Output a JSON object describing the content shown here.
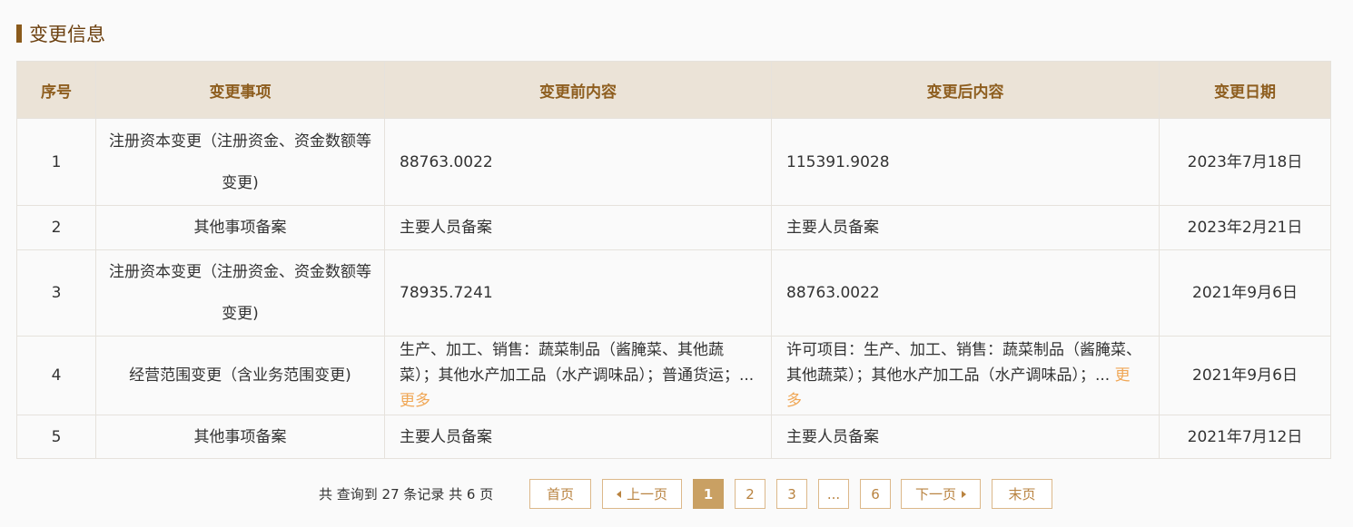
{
  "section": {
    "title": "变更信息"
  },
  "table": {
    "headers": [
      "序号",
      "变更事项",
      "变更前内容",
      "变更后内容",
      "变更日期"
    ],
    "rows": [
      {
        "index": "1",
        "item": "注册资本变更（注册资金、资金数额等变更)",
        "before": "88763.0022",
        "before_more": "",
        "after": "115391.9028",
        "after_more": "",
        "date": "2023年7月18日"
      },
      {
        "index": "2",
        "item": "其他事项备案",
        "before": "主要人员备案",
        "before_more": "",
        "after": "主要人员备案",
        "after_more": "",
        "date": "2023年2月21日"
      },
      {
        "index": "3",
        "item": "注册资本变更（注册资金、资金数额等变更)",
        "before": "78935.7241",
        "before_more": "",
        "after": "88763.0022",
        "after_more": "",
        "date": "2021年9月6日"
      },
      {
        "index": "4",
        "item": "经营范围变更（含业务范围变更)",
        "before": "生产、加工、销售：蔬菜制品（酱腌菜、其他蔬菜）；其他水产加工品（水产调味品）；普通货运；... ",
        "before_more": "更多",
        "after": "许可项目：生产、加工、销售：蔬菜制品（酱腌菜、其他蔬菜）；其他水产加工品（水产调味品）；... ",
        "after_more": "更多",
        "date": "2021年9月6日"
      },
      {
        "index": "5",
        "item": "其他事项备案",
        "before": "主要人员备案",
        "before_more": "",
        "after": "主要人员备案",
        "after_more": "",
        "date": "2021年7月12日"
      }
    ]
  },
  "pagination": {
    "summary": "共 查询到 27 条记录 共 6 页",
    "first": "首页",
    "prev": "上一页",
    "pages": [
      "1",
      "2",
      "3",
      "...",
      "6"
    ],
    "current": "1",
    "next": "下一页",
    "last": "末页"
  },
  "colors": {
    "accent": "#8a5a1b",
    "header_bg": "#ebe3d7",
    "header_text": "#8e5e1f",
    "link": "#f0a756",
    "pager_border": "#dcb88a",
    "pager_active": "#c9a063"
  }
}
